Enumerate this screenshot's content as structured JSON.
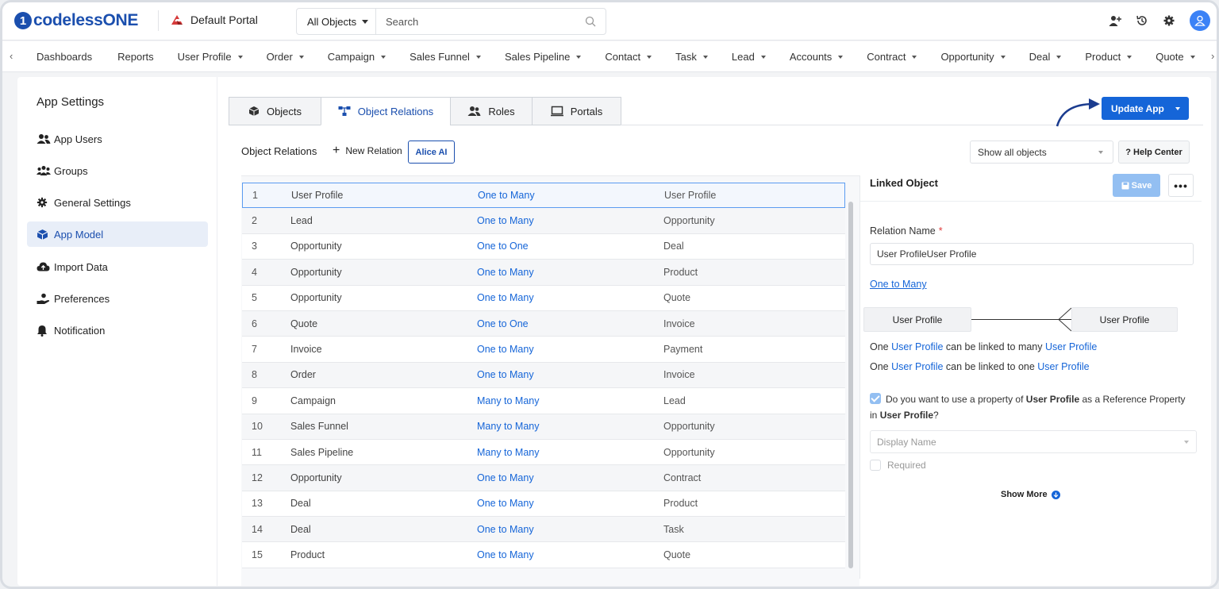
{
  "brand": {
    "logo_letter": "1",
    "logo_text": "codelessONE"
  },
  "portal": {
    "name": "Default Portal"
  },
  "search": {
    "scope": "All Objects",
    "placeholder": "Search"
  },
  "nav": {
    "items": [
      "Dashboards",
      "Reports",
      "User Profile",
      "Order",
      "Campaign",
      "Sales Funnel",
      "Sales Pipeline",
      "Contact",
      "Task",
      "Lead",
      "Accounts",
      "Contract",
      "Opportunity",
      "Deal",
      "Product",
      "Quote",
      "I"
    ],
    "has_caret": [
      false,
      false,
      true,
      true,
      true,
      true,
      true,
      true,
      true,
      true,
      true,
      true,
      true,
      true,
      true,
      true,
      false
    ]
  },
  "sidebar": {
    "title": "App Settings",
    "items": [
      {
        "label": "App Users",
        "icon": "users-icon"
      },
      {
        "label": "Groups",
        "icon": "groups-icon"
      },
      {
        "label": "General Settings",
        "icon": "gear-icon"
      },
      {
        "label": "App Model",
        "icon": "cube-icon",
        "active": true
      },
      {
        "label": "Import Data",
        "icon": "cloud-upload-icon"
      },
      {
        "label": "Preferences",
        "icon": "hand-icon"
      },
      {
        "label": "Notification",
        "icon": "bell-icon"
      }
    ]
  },
  "tabs": [
    {
      "label": "Objects",
      "icon": "cube-icon"
    },
    {
      "label": "Object Relations",
      "icon": "relations-icon",
      "active": true
    },
    {
      "label": "Roles",
      "icon": "users-icon"
    },
    {
      "label": "Portals",
      "icon": "monitor-icon"
    }
  ],
  "actions": {
    "update_app": "Update App",
    "help_center": "? Help Center"
  },
  "toolbar": {
    "title": "Object Relations",
    "new_relation": "New Relation",
    "alice_ai": "Alice AI",
    "filter": "Show all objects"
  },
  "relations": [
    {
      "n": "1",
      "a": "User Profile",
      "type": "One to Many",
      "b": "User Profile"
    },
    {
      "n": "2",
      "a": "Lead",
      "type": "One to Many",
      "b": "Opportunity"
    },
    {
      "n": "3",
      "a": "Opportunity",
      "type": "One to One",
      "b": "Deal"
    },
    {
      "n": "4",
      "a": "Opportunity",
      "type": "One to Many",
      "b": "Product"
    },
    {
      "n": "5",
      "a": "Opportunity",
      "type": "One to Many",
      "b": "Quote"
    },
    {
      "n": "6",
      "a": "Quote",
      "type": "One to One",
      "b": "Invoice"
    },
    {
      "n": "7",
      "a": "Invoice",
      "type": "One to Many",
      "b": "Payment"
    },
    {
      "n": "8",
      "a": "Order",
      "type": "One to Many",
      "b": "Invoice"
    },
    {
      "n": "9",
      "a": "Campaign",
      "type": "Many to Many",
      "b": "Lead"
    },
    {
      "n": "10",
      "a": "Sales Funnel",
      "type": "Many to Many",
      "b": "Opportunity"
    },
    {
      "n": "11",
      "a": "Sales Pipeline",
      "type": "Many to Many",
      "b": "Opportunity"
    },
    {
      "n": "12",
      "a": "Opportunity",
      "type": "One to Many",
      "b": "Contract"
    },
    {
      "n": "13",
      "a": "Deal",
      "type": "One to Many",
      "b": "Product"
    },
    {
      "n": "14",
      "a": "Deal",
      "type": "One to Many",
      "b": "Task"
    },
    {
      "n": "15",
      "a": "Product",
      "type": "One to Many",
      "b": "Quote"
    }
  ],
  "panel": {
    "title": "Linked Object",
    "save": "Save",
    "more": "•••",
    "relation_name_label": "Relation Name",
    "required_star": "*",
    "relation_name_value": "User ProfileUser Profile",
    "relation_type": "One to Many",
    "left_object": "User Profile",
    "right_object": "User Profile",
    "sentence1": {
      "pre": "One",
      "obj1": "User Profile",
      "mid": "can be linked to many",
      "obj2": "User Profile"
    },
    "sentence2": {
      "pre": "One",
      "obj1": "User Profile",
      "mid": "can be linked to one",
      "obj2": "User Profile"
    },
    "reference_question": {
      "pre": "Do you want to use a property of",
      "obj1": "User Profile",
      "mid": "as a Reference Property in",
      "obj2": "User Profile",
      "post": "?"
    },
    "display_name_placeholder": "Display Name",
    "required_label": "Required",
    "show_more": "Show More"
  }
}
